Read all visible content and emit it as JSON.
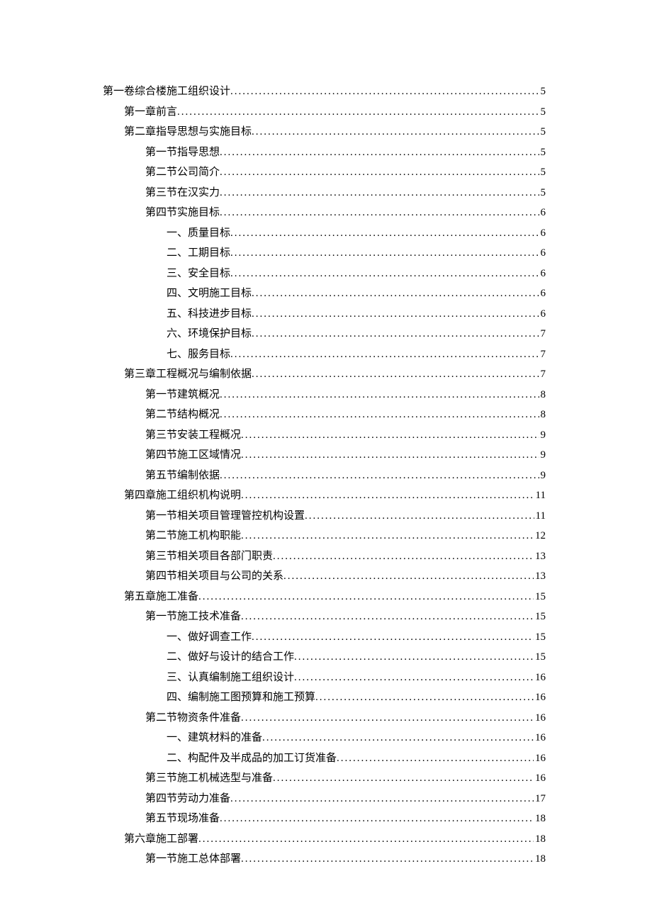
{
  "toc": [
    {
      "level": 0,
      "label": "第一卷综合楼施工组织设计",
      "page": "5"
    },
    {
      "level": 1,
      "label": "第一章前言",
      "page": "5"
    },
    {
      "level": 1,
      "label": "第二章指导思想与实施目标",
      "page": "5"
    },
    {
      "level": 2,
      "label": "第一节指导思想",
      "page": "5"
    },
    {
      "level": 2,
      "label": "第二节公司简介",
      "page": "5"
    },
    {
      "level": 2,
      "label": "第三节在汉实力",
      "page": "5"
    },
    {
      "level": 2,
      "label": "第四节实施目标",
      "page": "6"
    },
    {
      "level": 3,
      "label": "一、质量目标",
      "page": "6"
    },
    {
      "level": 3,
      "label": "二、工期目标",
      "page": "6"
    },
    {
      "level": 3,
      "label": "三、安全目标",
      "page": "6"
    },
    {
      "level": 3,
      "label": "四、文明施工目标",
      "page": "6"
    },
    {
      "level": 3,
      "label": "五、科技进步目标",
      "page": "6"
    },
    {
      "level": 3,
      "label": "六、环境保护目标",
      "page": "7"
    },
    {
      "level": 3,
      "label": "七、服务目标",
      "page": "7"
    },
    {
      "level": 1,
      "label": "第三章工程概况与编制依据",
      "page": "7"
    },
    {
      "level": 2,
      "label": "第一节建筑概况",
      "page": "8"
    },
    {
      "level": 2,
      "label": "第二节结构概况",
      "page": "8"
    },
    {
      "level": 2,
      "label": "第三节安装工程概况",
      "page": "9"
    },
    {
      "level": 2,
      "label": "第四节施工区域情况",
      "page": "9"
    },
    {
      "level": 2,
      "label": "第五节编制依据",
      "page": "9"
    },
    {
      "level": 1,
      "label": "第四章施工组织机构说明",
      "page": "11"
    },
    {
      "level": 2,
      "label": "第一节相关项目管理管控机构设置",
      "page": "11"
    },
    {
      "level": 2,
      "label": "第二节施工机构职能",
      "page": "12"
    },
    {
      "level": 2,
      "label": "第三节相关项目各部门职责",
      "page": "13"
    },
    {
      "level": 2,
      "label": "第四节相关项目与公司的关系",
      "page": "13"
    },
    {
      "level": 1,
      "label": "第五章施工准备",
      "page": "15"
    },
    {
      "level": 2,
      "label": "第一节施工技术准备",
      "page": "15"
    },
    {
      "level": 3,
      "label": "一、做好调查工作",
      "page": "15"
    },
    {
      "level": 3,
      "label": "二、做好与设计的结合工作",
      "page": "15"
    },
    {
      "level": 3,
      "label": "三、认真编制施工组织设计",
      "page": "16"
    },
    {
      "level": 3,
      "label": "四、编制施工图预算和施工预算",
      "page": "16"
    },
    {
      "level": 2,
      "label": "第二节物资条件准备",
      "page": "16"
    },
    {
      "level": 3,
      "label": "一、建筑材料的准备",
      "page": "16"
    },
    {
      "level": 3,
      "label": "二、构配件及半成品的加工订货准备",
      "page": "16"
    },
    {
      "level": 2,
      "label": "第三节施工机械选型与准备",
      "page": "16"
    },
    {
      "level": 2,
      "label": "第四节劳动力准备",
      "page": "17"
    },
    {
      "level": 2,
      "label": "第五节现场准备",
      "page": "18"
    },
    {
      "level": 1,
      "label": "第六章施工部署",
      "page": "18"
    },
    {
      "level": 2,
      "label": "第一节施工总体部署",
      "page": "18"
    }
  ]
}
